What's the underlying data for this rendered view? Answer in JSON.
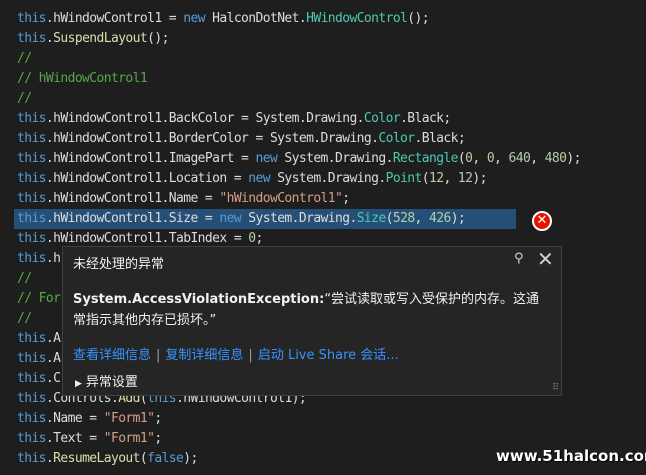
{
  "code_lines": [
    [
      {
        "t": "k",
        "v": "this"
      },
      {
        "t": "p",
        "v": ".hWindowControl1 = "
      },
      {
        "t": "k",
        "v": "new"
      },
      {
        "t": "p",
        "v": " HalconDotNet."
      },
      {
        "t": "t",
        "v": "HWindowControl"
      },
      {
        "t": "p",
        "v": "();"
      }
    ],
    [
      {
        "t": "k",
        "v": "this"
      },
      {
        "t": "p",
        "v": "."
      },
      {
        "t": "m",
        "v": "SuspendLayout"
      },
      {
        "t": "p",
        "v": "();"
      }
    ],
    [
      {
        "t": "c",
        "v": "//"
      }
    ],
    [
      {
        "t": "c",
        "v": "// hWindowControl1"
      }
    ],
    [
      {
        "t": "c",
        "v": "//"
      }
    ],
    [
      {
        "t": "k",
        "v": "this"
      },
      {
        "t": "p",
        "v": ".hWindowControl1.BackColor = System.Drawing."
      },
      {
        "t": "t",
        "v": "Color"
      },
      {
        "t": "p",
        "v": ".Black;"
      }
    ],
    [
      {
        "t": "k",
        "v": "this"
      },
      {
        "t": "p",
        "v": ".hWindowControl1.BorderColor = System.Drawing."
      },
      {
        "t": "t",
        "v": "Color"
      },
      {
        "t": "p",
        "v": ".Black;"
      }
    ],
    [
      {
        "t": "k",
        "v": "this"
      },
      {
        "t": "p",
        "v": ".hWindowControl1.ImagePart = "
      },
      {
        "t": "k",
        "v": "new"
      },
      {
        "t": "p",
        "v": " System.Drawing."
      },
      {
        "t": "t",
        "v": "Rectangle"
      },
      {
        "t": "p",
        "v": "("
      },
      {
        "t": "n",
        "v": "0"
      },
      {
        "t": "p",
        "v": ", "
      },
      {
        "t": "n",
        "v": "0"
      },
      {
        "t": "p",
        "v": ", "
      },
      {
        "t": "n",
        "v": "640"
      },
      {
        "t": "p",
        "v": ", "
      },
      {
        "t": "n",
        "v": "480"
      },
      {
        "t": "p",
        "v": ");"
      }
    ],
    [
      {
        "t": "k",
        "v": "this"
      },
      {
        "t": "p",
        "v": ".hWindowControl1.Location = "
      },
      {
        "t": "k",
        "v": "new"
      },
      {
        "t": "p",
        "v": " System.Drawing."
      },
      {
        "t": "t",
        "v": "Point"
      },
      {
        "t": "p",
        "v": "("
      },
      {
        "t": "n",
        "v": "12"
      },
      {
        "t": "p",
        "v": ", "
      },
      {
        "t": "n",
        "v": "12"
      },
      {
        "t": "p",
        "v": ");"
      }
    ],
    [
      {
        "t": "k",
        "v": "this"
      },
      {
        "t": "p",
        "v": ".hWindowControl1.Name = "
      },
      {
        "t": "s",
        "v": "\"hWindowControl1\""
      },
      {
        "t": "p",
        "v": ";"
      }
    ],
    [
      {
        "t": "k",
        "v": "this"
      },
      {
        "t": "p",
        "v": ".hWindowControl1.Size = "
      },
      {
        "t": "k",
        "v": "new"
      },
      {
        "t": "p",
        "v": " System.Drawing."
      },
      {
        "t": "t",
        "v": "Size"
      },
      {
        "t": "p",
        "v": "("
      },
      {
        "t": "n",
        "v": "528"
      },
      {
        "t": "p",
        "v": ", "
      },
      {
        "t": "n",
        "v": "426"
      },
      {
        "t": "p",
        "v": ");"
      }
    ],
    [
      {
        "t": "k",
        "v": "this"
      },
      {
        "t": "p",
        "v": ".hWindowControl1.TabIndex = "
      },
      {
        "t": "n",
        "v": "0"
      },
      {
        "t": "p",
        "v": ";"
      }
    ],
    [
      {
        "t": "k",
        "v": "this"
      },
      {
        "t": "p",
        "v": ".h"
      }
    ],
    [
      {
        "t": "c",
        "v": "//"
      }
    ],
    [
      {
        "t": "c",
        "v": "// For"
      }
    ],
    [
      {
        "t": "c",
        "v": "//"
      }
    ],
    [
      {
        "t": "k",
        "v": "this"
      },
      {
        "t": "p",
        "v": ".A"
      }
    ],
    [
      {
        "t": "k",
        "v": "this"
      },
      {
        "t": "p",
        "v": ".A"
      }
    ],
    [
      {
        "t": "k",
        "v": "this"
      },
      {
        "t": "p",
        "v": ".C"
      }
    ],
    [
      {
        "t": "k",
        "v": "this"
      },
      {
        "t": "p",
        "v": ".Controls."
      },
      {
        "t": "m",
        "v": "Add"
      },
      {
        "t": "p",
        "v": "("
      },
      {
        "t": "k",
        "v": "this"
      },
      {
        "t": "p",
        "v": ".hWindowControl1);"
      }
    ],
    [
      {
        "t": "k",
        "v": "this"
      },
      {
        "t": "p",
        "v": ".Name = "
      },
      {
        "t": "s",
        "v": "\"Form1\""
      },
      {
        "t": "p",
        "v": ";"
      }
    ],
    [
      {
        "t": "k",
        "v": "this"
      },
      {
        "t": "p",
        "v": ".Text = "
      },
      {
        "t": "s",
        "v": "\"Form1\""
      },
      {
        "t": "p",
        "v": ";"
      }
    ],
    [
      {
        "t": "k",
        "v": "this"
      },
      {
        "t": "p",
        "v": "."
      },
      {
        "t": "m",
        "v": "ResumeLayout"
      },
      {
        "t": "p",
        "v": "("
      },
      {
        "t": "k",
        "v": "false"
      },
      {
        "t": "p",
        "v": ");"
      }
    ]
  ],
  "popup": {
    "title": "未经处理的异常",
    "exception_type": "System.AccessViolationException:",
    "exception_message": "“尝试读取或写入受保护的内存。这通常指示其他内存已损坏。”",
    "links": [
      "查看详细信息",
      "复制详细信息",
      "启动 Live Share 会话..."
    ],
    "settings_label": "异常设置"
  },
  "icons": {
    "error": "error-circle-icon",
    "pin": "pin-icon",
    "close": "close-icon",
    "expand": "triangle-right-icon",
    "grip": "resize-grip-icon"
  },
  "colors": {
    "editor_bg": "#1e1e1e",
    "keyword": "#569cd6",
    "type": "#4ec9b0",
    "comment": "#57a64a",
    "string": "#d69d85",
    "error": "#e51400",
    "link": "#3794ff"
  },
  "watermark": "www.51halcon.com"
}
